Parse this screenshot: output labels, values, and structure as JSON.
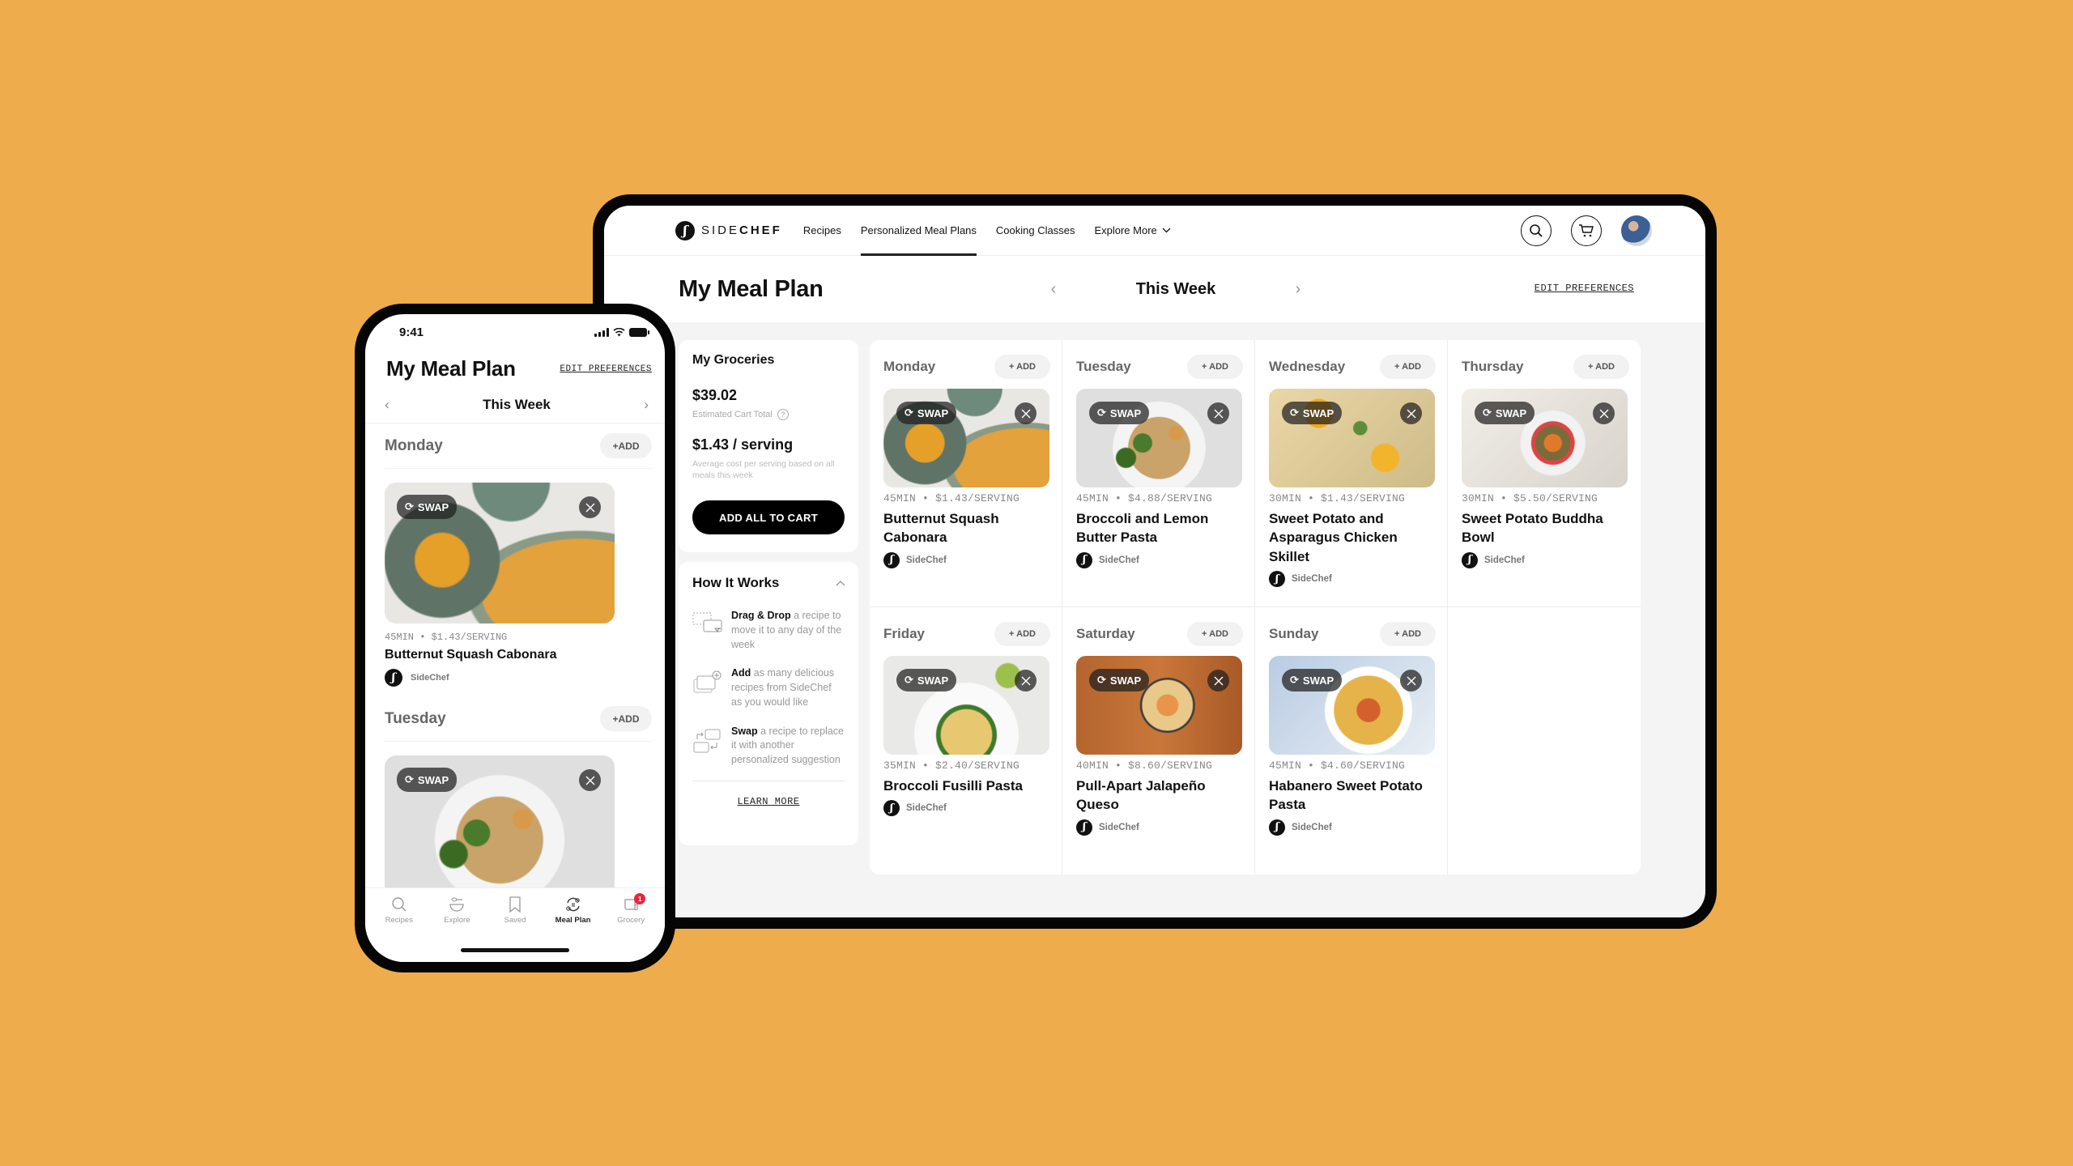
{
  "colors": {
    "background": "#EEAC4D",
    "primary": "#000000",
    "badge": "#E8263B"
  },
  "tablet": {
    "brand": {
      "name_light": "SIDE",
      "name_bold": "CHEF"
    },
    "nav": [
      {
        "label": "Recipes",
        "active": false
      },
      {
        "label": "Personalized Meal Plans",
        "active": true
      },
      {
        "label": "Cooking Classes",
        "active": false
      },
      {
        "label": "Explore More",
        "active": false,
        "has_dropdown": true
      }
    ],
    "nav_icons": [
      "search-icon",
      "cart-icon",
      "avatar"
    ],
    "title": "My Meal Plan",
    "week": {
      "label": "This Week",
      "prev_icon": "chevron-left",
      "next_icon": "chevron-right"
    },
    "edit_preferences": "EDIT PREFERENCES",
    "groceries": {
      "title": "My Groceries",
      "total": "$39.02",
      "total_label": "Estimated Cart Total",
      "per_serving": "$1.43 / serving",
      "per_serving_note": "Average cost per serving based on all meals this week",
      "button": "ADD ALL TO CART"
    },
    "how_it_works": {
      "title": "How It Works",
      "items": [
        {
          "bold": "Drag & Drop",
          "text": " a recipe to move it to any day of the week",
          "icon": "drag-drop-icon"
        },
        {
          "bold": "Add",
          "text": " as many delicious recipes from SideChef as you would like",
          "icon": "add-recipe-icon"
        },
        {
          "bold": "Swap",
          "text": " a recipe to replace it with another personalized suggestion",
          "icon": "swap-recipe-icon"
        }
      ],
      "learn_more": "LEARN MORE"
    },
    "add_label": "+ ADD",
    "swap_label": "SWAP",
    "days": [
      {
        "day": "Monday",
        "meta": "45MIN • $1.43/SERVING",
        "recipe": "Butternut Squash Cabonara",
        "author": "SideChef",
        "img": "f-squash"
      },
      {
        "day": "Tuesday",
        "meta": "45MIN • $4.88/SERVING",
        "recipe": "Broccoli and Lemon Butter Pasta",
        "author": "SideChef",
        "img": "f-broc"
      },
      {
        "day": "Wednesday",
        "meta": "30MIN • $1.43/SERVING",
        "recipe": "Sweet Potato and Asparagus Chicken Skillet",
        "author": "SideChef",
        "img": "f-swpot"
      },
      {
        "day": "Thursday",
        "meta": "30MIN • $5.50/SERVING",
        "recipe": "Sweet Potato Buddha Bowl",
        "author": "SideChef",
        "img": "f-buddha"
      },
      {
        "day": "Friday",
        "meta": "35MIN • $2.40/SERVING",
        "recipe": "Broccoli Fusilli Pasta",
        "author": "SideChef",
        "img": "f-fusilli"
      },
      {
        "day": "Saturday",
        "meta": "40MIN • $8.60/SERVING",
        "recipe": "Pull-Apart  Jalapeño Queso",
        "author": "SideChef",
        "img": "f-queso"
      },
      {
        "day": "Sunday",
        "meta": "45MIN • $4.60/SERVING",
        "recipe": "Habanero Sweet Potato Pasta",
        "author": "SideChef",
        "img": "f-habanero"
      }
    ]
  },
  "phone": {
    "time": "9:41",
    "title": "My Meal Plan",
    "edit_preferences": "EDIT PREFERENCES",
    "week_label": "This Week",
    "add_label": "+ADD",
    "swap_label": "SWAP",
    "days": [
      {
        "day": "Monday",
        "meta": "45MIN • $1.43/SERVING",
        "recipe": "Butternut Squash Cabonara",
        "author": "SideChef",
        "img": "f-squash"
      },
      {
        "day": "Tuesday",
        "img": "f-broc"
      }
    ],
    "tabs": [
      {
        "label": "Recipes",
        "icon": "search-icon",
        "active": false
      },
      {
        "label": "Explore",
        "icon": "explore-bowl-icon",
        "active": false
      },
      {
        "label": "Saved",
        "icon": "bookmark-icon",
        "active": false
      },
      {
        "label": "Meal Plan",
        "icon": "meal-plan-icon",
        "active": true
      },
      {
        "label": "Grocery",
        "icon": "grocery-list-icon",
        "active": false,
        "badge": "1"
      }
    ]
  }
}
